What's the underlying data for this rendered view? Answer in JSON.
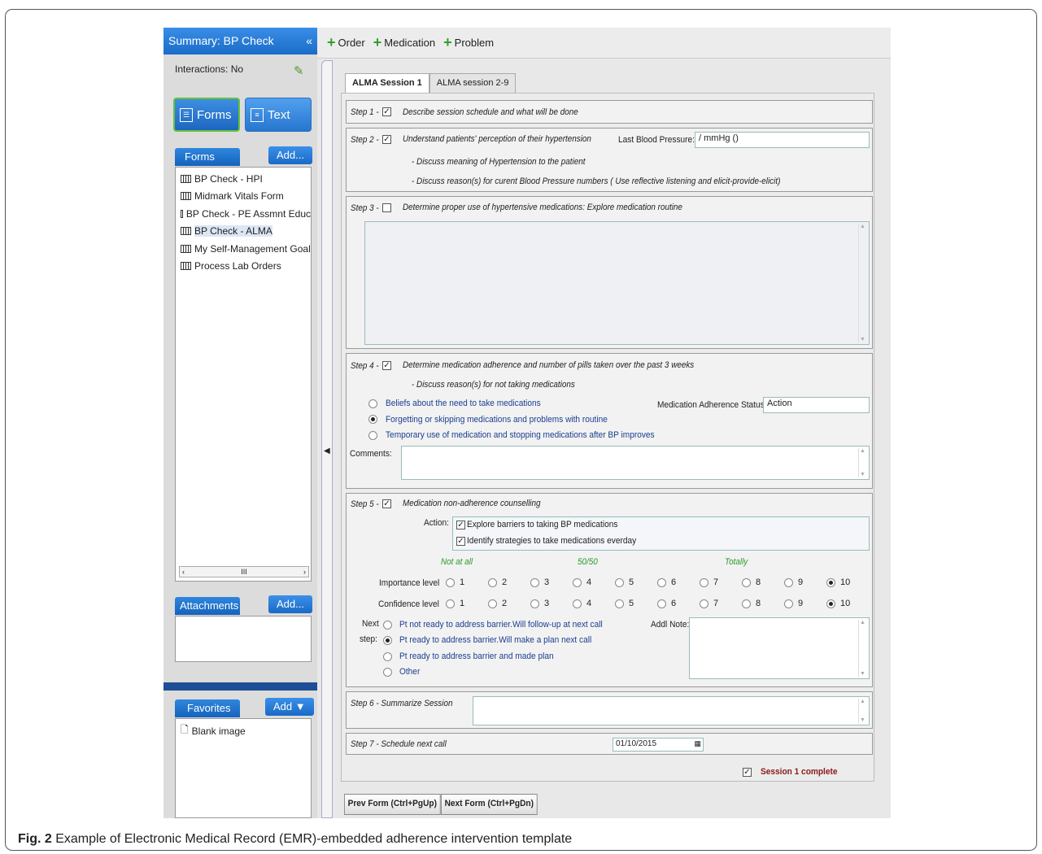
{
  "sidebar": {
    "title": "Summary: BP Check",
    "collapse": "«",
    "interactions": "Interactions: No",
    "forms_btn": "Forms",
    "text_btn": "Text",
    "forms_header": "Forms",
    "forms_add": "Add...",
    "forms": [
      "BP Check - HPI",
      "Midmark Vitals Form",
      "BP Check - PE Assmnt Educ",
      "BP Check - ALMA",
      "My Self-Management Goal",
      "Process Lab Orders"
    ],
    "hscroll_mid": "III",
    "attachments_header": "Attachments",
    "attachments_add": "Add...",
    "favorites_header": "Favorites",
    "favorites_add": "Add ▼",
    "favorites": [
      "Blank image"
    ]
  },
  "toolbar": {
    "order": "Order",
    "medication": "Medication",
    "problem": "Problem"
  },
  "tabs": [
    "ALMA Session 1",
    "ALMA session 2-9"
  ],
  "steps": {
    "s1_label": "Step 1 -",
    "s1_text": "Describe session schedule and what will be done",
    "s2_label": "Step 2 -",
    "s2_text": "Understand patients' perception of their hypertension",
    "s2_bp_label": "Last Blood Pressure:",
    "s2_bp_value": "/ mmHg ()",
    "s2_sub1": "- Discuss meaning of Hypertension to the patient",
    "s2_sub2": "- Discuss reason(s) for curent Blood Pressure numbers ( Use reflective listening and elicit-provide-elicit)",
    "s3_label": "Step 3 -",
    "s3_text": "Determine proper use of hypertensive medications:  Explore medication routine",
    "s4_label": "Step 4 -",
    "s4_text": "Determine medication adherence and number of pills taken over the past 3 weeks",
    "s4_sub": "- Discuss reason(s) for not taking medications",
    "s4_opt1": "Beliefs about the need to take medications",
    "s4_opt2": "Forgetting or skipping medications and problems with routine",
    "s4_opt3": "Temporary use of medication and stopping medications after BP improves",
    "s4_status_label": "Medication Adherence Status:",
    "s4_status_value": "Action",
    "s4_comments": "Comments:",
    "s5_label": "Step 5 -",
    "s5_text": "Medication non-adherence counselling",
    "s5_action": "Action:",
    "s5_act1": "Explore barriers to taking BP medications",
    "s5_act2": "Identify strategies to take medications everday",
    "scale_low": "Not at all",
    "scale_mid": "50/50",
    "scale_high": "Totally",
    "importance": "Importance level",
    "confidence": "Confidence level",
    "scale_values": [
      "1",
      "2",
      "3",
      "4",
      "5",
      "6",
      "7",
      "8",
      "9",
      "10"
    ],
    "importance_selected": 10,
    "confidence_selected": 10,
    "next_label1": "Next",
    "next_label2": "step:",
    "next1": "Pt not ready to address barrier.Will follow-up at next call",
    "next2": "Pt ready to address barrier.Will make a plan next call",
    "next3": "Pt ready to address barrier and made plan",
    "next4": "Other",
    "addl_note": "Addl Note:",
    "s6_text": "Step 6 - Summarize Session",
    "s7_text": "Step 7 - Schedule next call",
    "s7_date": "01/10/2015",
    "complete": "Session 1 complete"
  },
  "buttons": {
    "prev": "Prev Form (Ctrl+PgUp)",
    "next": "Next Form (Ctrl+PgDn)"
  },
  "caption": {
    "bold": "Fig. 2",
    "text": " Example of Electronic Medical Record (EMR)-embedded adherence intervention template"
  },
  "colors": {
    "accent": "#1a6cc8",
    "green": "#2a9a2a",
    "complete": "#8b1a1a"
  }
}
